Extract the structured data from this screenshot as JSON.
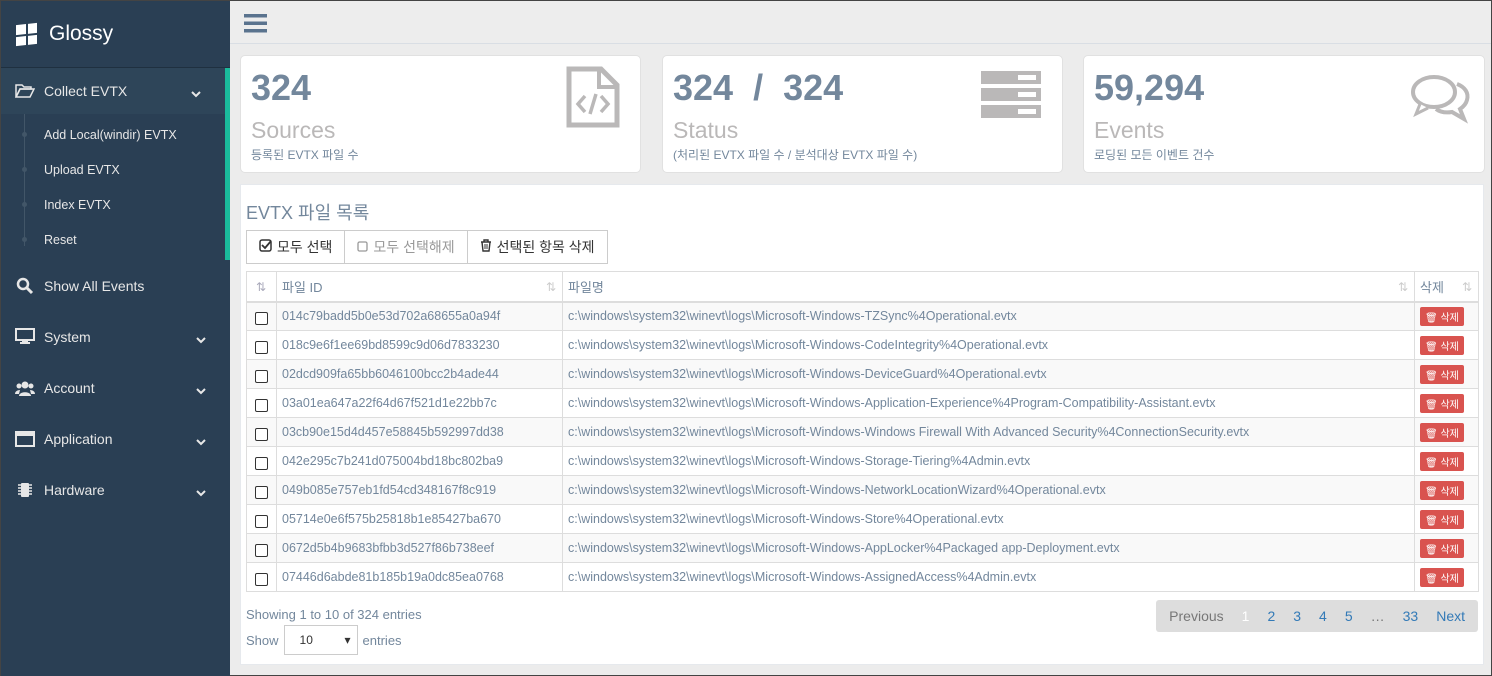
{
  "brand": {
    "name": "Glossy"
  },
  "sidebar": {
    "collect": {
      "label": "Collect EVTX",
      "icon": "folder-open-icon"
    },
    "sub": [
      {
        "label": "Add Local(windir) EVTX"
      },
      {
        "label": "Upload EVTX"
      },
      {
        "label": "Index EVTX"
      },
      {
        "label": "Reset"
      }
    ],
    "items": [
      {
        "label": "Show All Events",
        "icon": "search-icon"
      },
      {
        "label": "System",
        "icon": "desktop-icon"
      },
      {
        "label": "Account",
        "icon": "users-icon"
      },
      {
        "label": "Application",
        "icon": "window-icon"
      },
      {
        "label": "Hardware",
        "icon": "chip-icon"
      }
    ]
  },
  "tiles": [
    {
      "num": "324",
      "label": "Sources",
      "desc": "등록된 EVTX 파일 수",
      "icon": "file-code-icon"
    },
    {
      "num": "324  /  324",
      "label": "Status",
      "desc": "(처리된 EVTX 파일 수 / 분석대상 EVTX 파일 수)",
      "icon": "server-icon"
    },
    {
      "num": "59,294",
      "label": "Events",
      "desc": "로딩된 모든 이벤트 건수",
      "icon": "comments-icon"
    }
  ],
  "panel": {
    "title": "EVTX 파일 목록",
    "select_all": "모두 선택",
    "deselect_all": "모두 선택해제",
    "delete_selected": "선택된 항목 삭제",
    "columns": [
      "파일 ID",
      "파일명",
      "삭제"
    ],
    "delete_label": "삭제",
    "rows": [
      {
        "id": "014c79badd5b0e53d702a68655a0a94f",
        "name": "c:\\windows\\system32\\winevt\\logs\\Microsoft-Windows-TZSync%4Operational.evtx"
      },
      {
        "id": "018c9e6f1ee69bd8599c9d06d7833230",
        "name": "c:\\windows\\system32\\winevt\\logs\\Microsoft-Windows-CodeIntegrity%4Operational.evtx"
      },
      {
        "id": "02dcd909fa65bb6046100bcc2b4ade44",
        "name": "c:\\windows\\system32\\winevt\\logs\\Microsoft-Windows-DeviceGuard%4Operational.evtx"
      },
      {
        "id": "03a01ea647a22f64d67f521d1e22bb7c",
        "name": "c:\\windows\\system32\\winevt\\logs\\Microsoft-Windows-Application-Experience%4Program-Compatibility-Assistant.evtx"
      },
      {
        "id": "03cb90e15d4d457e58845b592997dd38",
        "name": "c:\\windows\\system32\\winevt\\logs\\Microsoft-Windows-Windows Firewall With Advanced Security%4ConnectionSecurity.evtx"
      },
      {
        "id": "042e295c7b241d075004bd18bc802ba9",
        "name": "c:\\windows\\system32\\winevt\\logs\\Microsoft-Windows-Storage-Tiering%4Admin.evtx"
      },
      {
        "id": "049b085e757eb1fd54cd348167f8c919",
        "name": "c:\\windows\\system32\\winevt\\logs\\Microsoft-Windows-NetworkLocationWizard%4Operational.evtx"
      },
      {
        "id": "05714e0e6f575b25818b1e85427ba670",
        "name": "c:\\windows\\system32\\winevt\\logs\\Microsoft-Windows-Store%4Operational.evtx"
      },
      {
        "id": "0672d5b4b9683bfbb3d527f86b738eef",
        "name": "c:\\windows\\system32\\winevt\\logs\\Microsoft-Windows-AppLocker%4Packaged app-Deployment.evtx"
      },
      {
        "id": "07446d6abde81b185b19a0dc85ea0768",
        "name": "c:\\windows\\system32\\winevt\\logs\\Microsoft-Windows-AssignedAccess%4Admin.evtx"
      }
    ],
    "info": "Showing 1 to 10 of 324 entries",
    "show_label": "Show",
    "page_size": "10",
    "entries_label": "entries",
    "pager": {
      "prev": "Previous",
      "pages": [
        "1",
        "2",
        "3",
        "4",
        "5",
        "…",
        "33"
      ],
      "current": "1",
      "next": "Next"
    }
  },
  "colors": {
    "sidebar": "#2a3f54",
    "accent": "#1abb9c",
    "danger": "#d9534f",
    "link": "#337ab7"
  }
}
